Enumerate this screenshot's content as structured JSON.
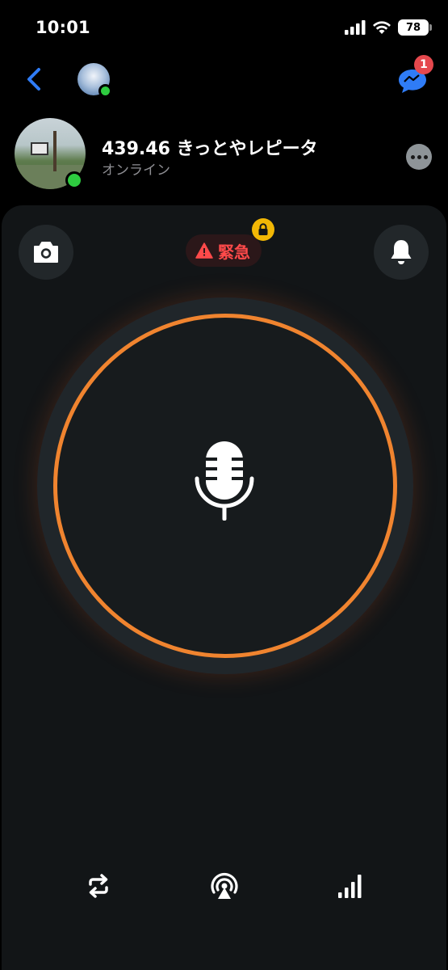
{
  "status_bar": {
    "time": "10:01",
    "battery": "78"
  },
  "nav": {
    "chat_badge": "1"
  },
  "channel": {
    "title": "439.46 きっとやレピータ",
    "status": "オンライン"
  },
  "panel": {
    "emergency_label": "緊急"
  },
  "colors": {
    "accent": "#f0842f",
    "online": "#2ecc40",
    "emergency": "#ff4a4a",
    "back": "#2f7cf6",
    "chat": "#2f7cf6",
    "badge": "#e5484d",
    "lock": "#f2b705"
  },
  "icons": [
    "chevron-left-icon",
    "chat-icon",
    "more-icon",
    "camera-icon",
    "bell-icon",
    "warning-icon",
    "lock-icon",
    "microphone-icon",
    "repeat-icon",
    "broadcast-icon",
    "signal-icon"
  ]
}
